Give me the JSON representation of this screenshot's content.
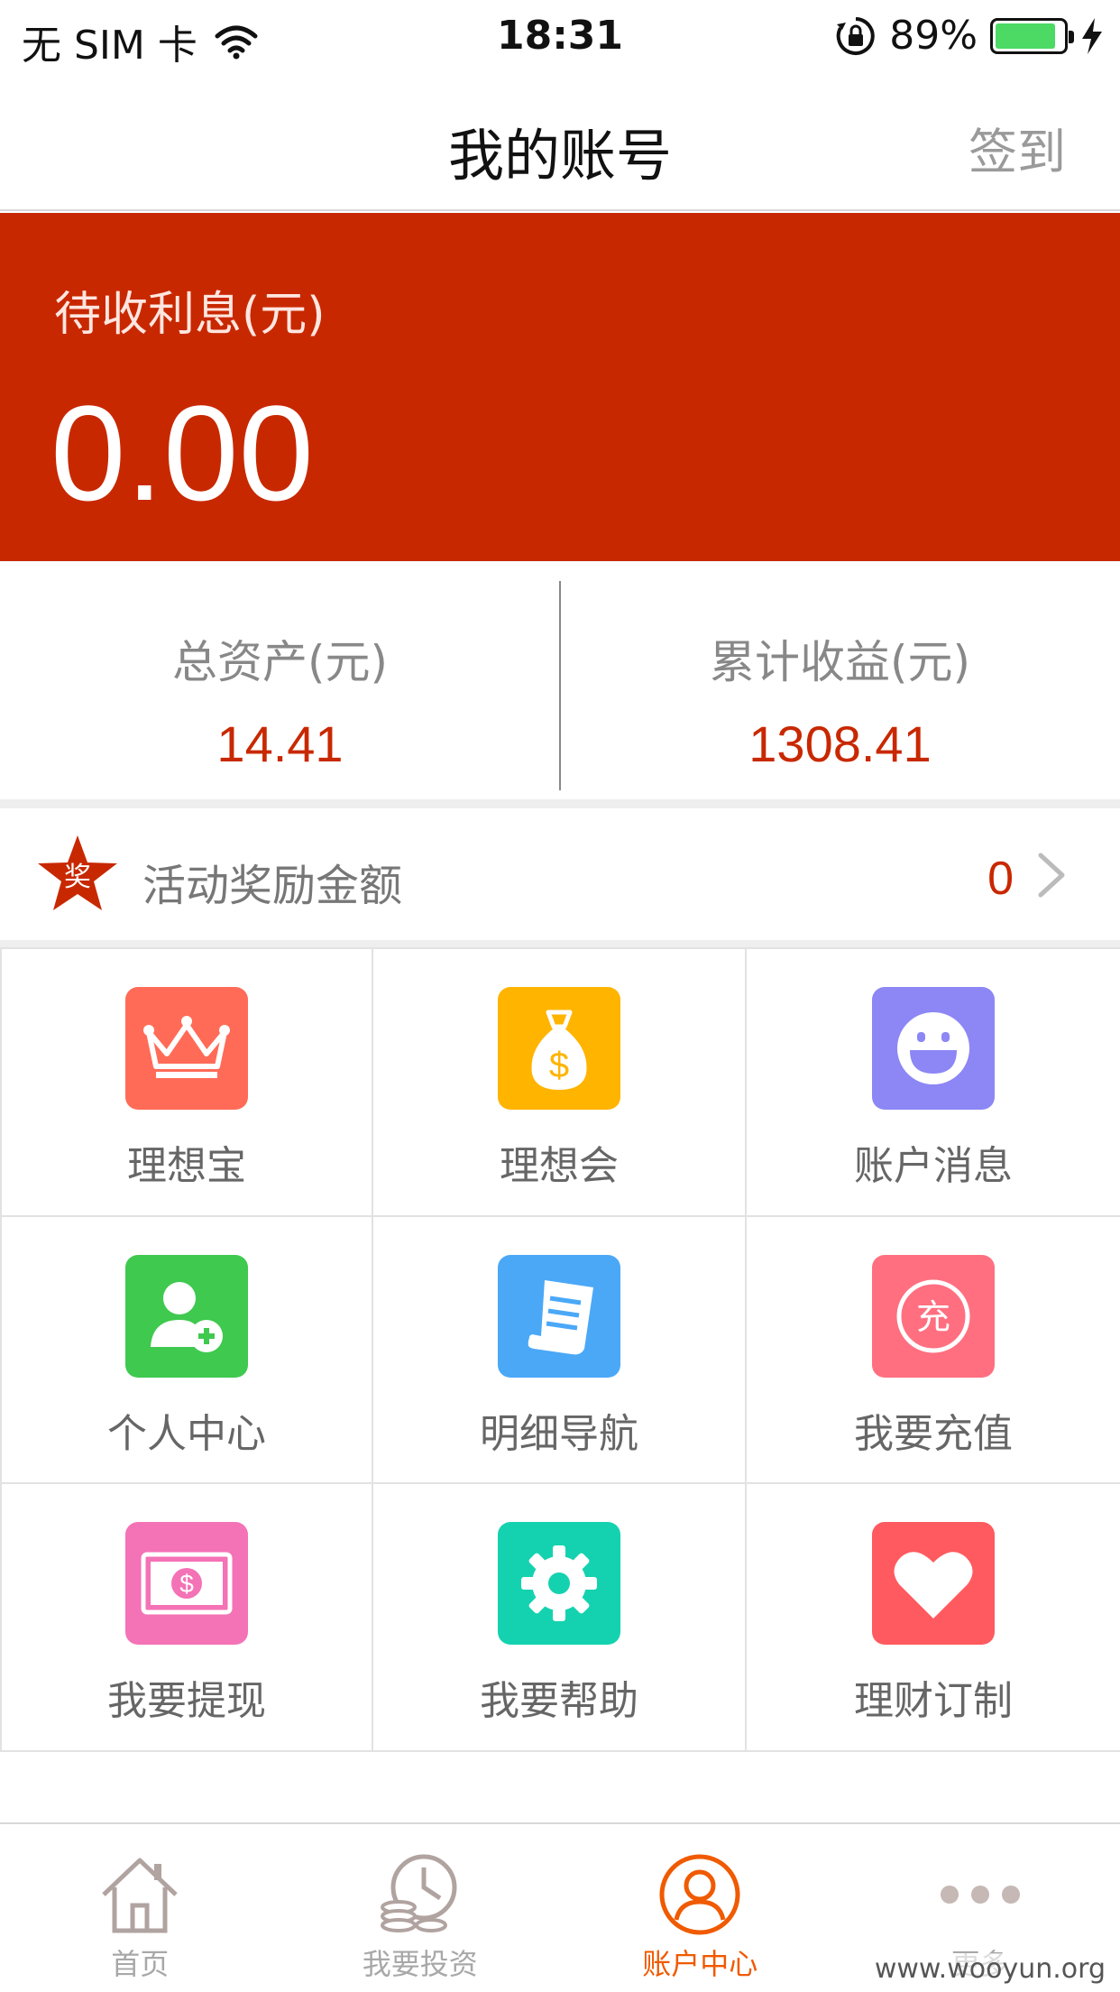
{
  "status_bar": {
    "carrier": "无 SIM 卡",
    "time": "18:31",
    "battery_percent": "89%",
    "battery_level": 0.89
  },
  "nav": {
    "title": "我的账号",
    "signin": "签到"
  },
  "hero": {
    "label": "待收利息(元)",
    "value": "0.00",
    "color": "#c82800"
  },
  "stats": [
    {
      "label": "总资产(元)",
      "value": "14.41"
    },
    {
      "label": "累计收益(元)",
      "value": "1308.41"
    }
  ],
  "reward": {
    "badge": "奖",
    "label": "活动奖励金额",
    "count": "0"
  },
  "grid": [
    {
      "label": "理想宝",
      "icon": "crown-icon",
      "color": "#ff6b57"
    },
    {
      "label": "理想会",
      "icon": "money-bag-icon",
      "color": "#ffb400"
    },
    {
      "label": "账户消息",
      "icon": "smiley-icon",
      "color": "#8c87f5"
    },
    {
      "label": "个人中心",
      "icon": "user-add-icon",
      "color": "#3fc94f"
    },
    {
      "label": "明细导航",
      "icon": "receipt-icon",
      "color": "#4aa8f7"
    },
    {
      "label": "我要充值",
      "icon": "recharge-icon",
      "glyph": "充",
      "color": "#ff6f80"
    },
    {
      "label": "我要提现",
      "icon": "cash-icon",
      "color": "#f472b6"
    },
    {
      "label": "我要帮助",
      "icon": "gear-icon",
      "color": "#14d2b0"
    },
    {
      "label": "理财订制",
      "icon": "heart-icon",
      "color": "#ff5a5f"
    }
  ],
  "tabs": [
    {
      "label": "首页",
      "icon": "home-icon",
      "active": false
    },
    {
      "label": "我要投资",
      "icon": "coins-clock-icon",
      "active": false
    },
    {
      "label": "账户中心",
      "icon": "account-icon",
      "active": true
    },
    {
      "label": "更多",
      "icon": "more-dots-icon",
      "active": false
    }
  ],
  "watermark": "www.wooyun.org"
}
